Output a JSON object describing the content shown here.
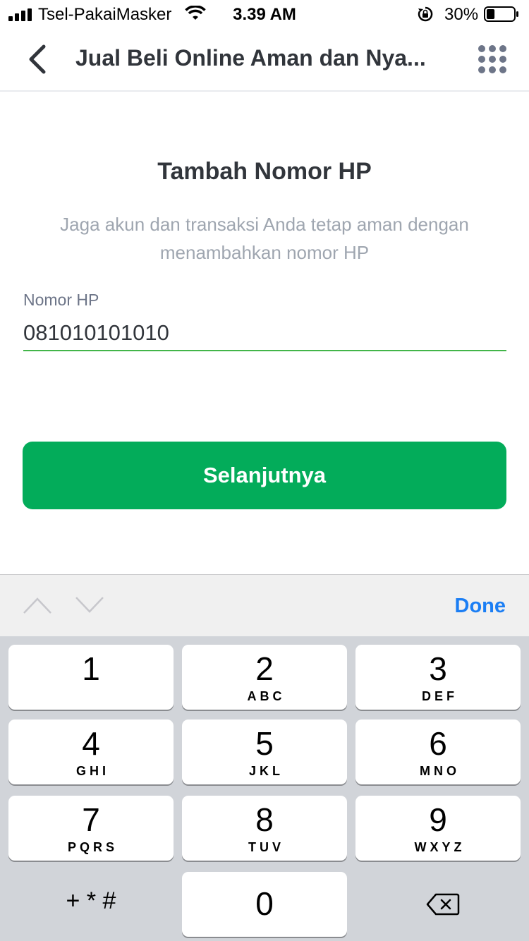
{
  "status_bar": {
    "carrier": "Tsel-PakaiMasker",
    "time": "3.39 AM",
    "battery_percent": "30%",
    "battery_level": 0.3,
    "icons": [
      "signal-icon",
      "wifi-icon",
      "orientation-lock-icon",
      "battery-icon"
    ]
  },
  "nav": {
    "title": "Jual Beli Online Aman dan Nya...",
    "back_icon": "chevron-left-icon",
    "menu_icon": "grid-dots-icon"
  },
  "content": {
    "title": "Tambah Nomor HP",
    "subtitle": "Jaga akun dan transaksi Anda tetap aman dengan menambahkan nomor HP",
    "field_label": "Nomor HP",
    "phone_value": "081010101010",
    "next_button": "Selanjutnya"
  },
  "keyboard": {
    "accessory": {
      "done": "Done",
      "prev_icon": "chevron-up-icon",
      "next_icon": "chevron-down-icon"
    },
    "keys": [
      {
        "num": "1",
        "letters": ""
      },
      {
        "num": "2",
        "letters": "ABC"
      },
      {
        "num": "3",
        "letters": "DEF"
      },
      {
        "num": "4",
        "letters": "GHI"
      },
      {
        "num": "5",
        "letters": "JKL"
      },
      {
        "num": "6",
        "letters": "MNO"
      },
      {
        "num": "7",
        "letters": "PQRS"
      },
      {
        "num": "8",
        "letters": "TUV"
      },
      {
        "num": "9",
        "letters": "WXYZ"
      }
    ],
    "symbols": "+ * #",
    "zero": "0",
    "delete_icon": "backspace-icon"
  },
  "colors": {
    "primary_green": "#03ac5a",
    "input_underline": "#42b549",
    "link_blue": "#1b7ef4"
  }
}
